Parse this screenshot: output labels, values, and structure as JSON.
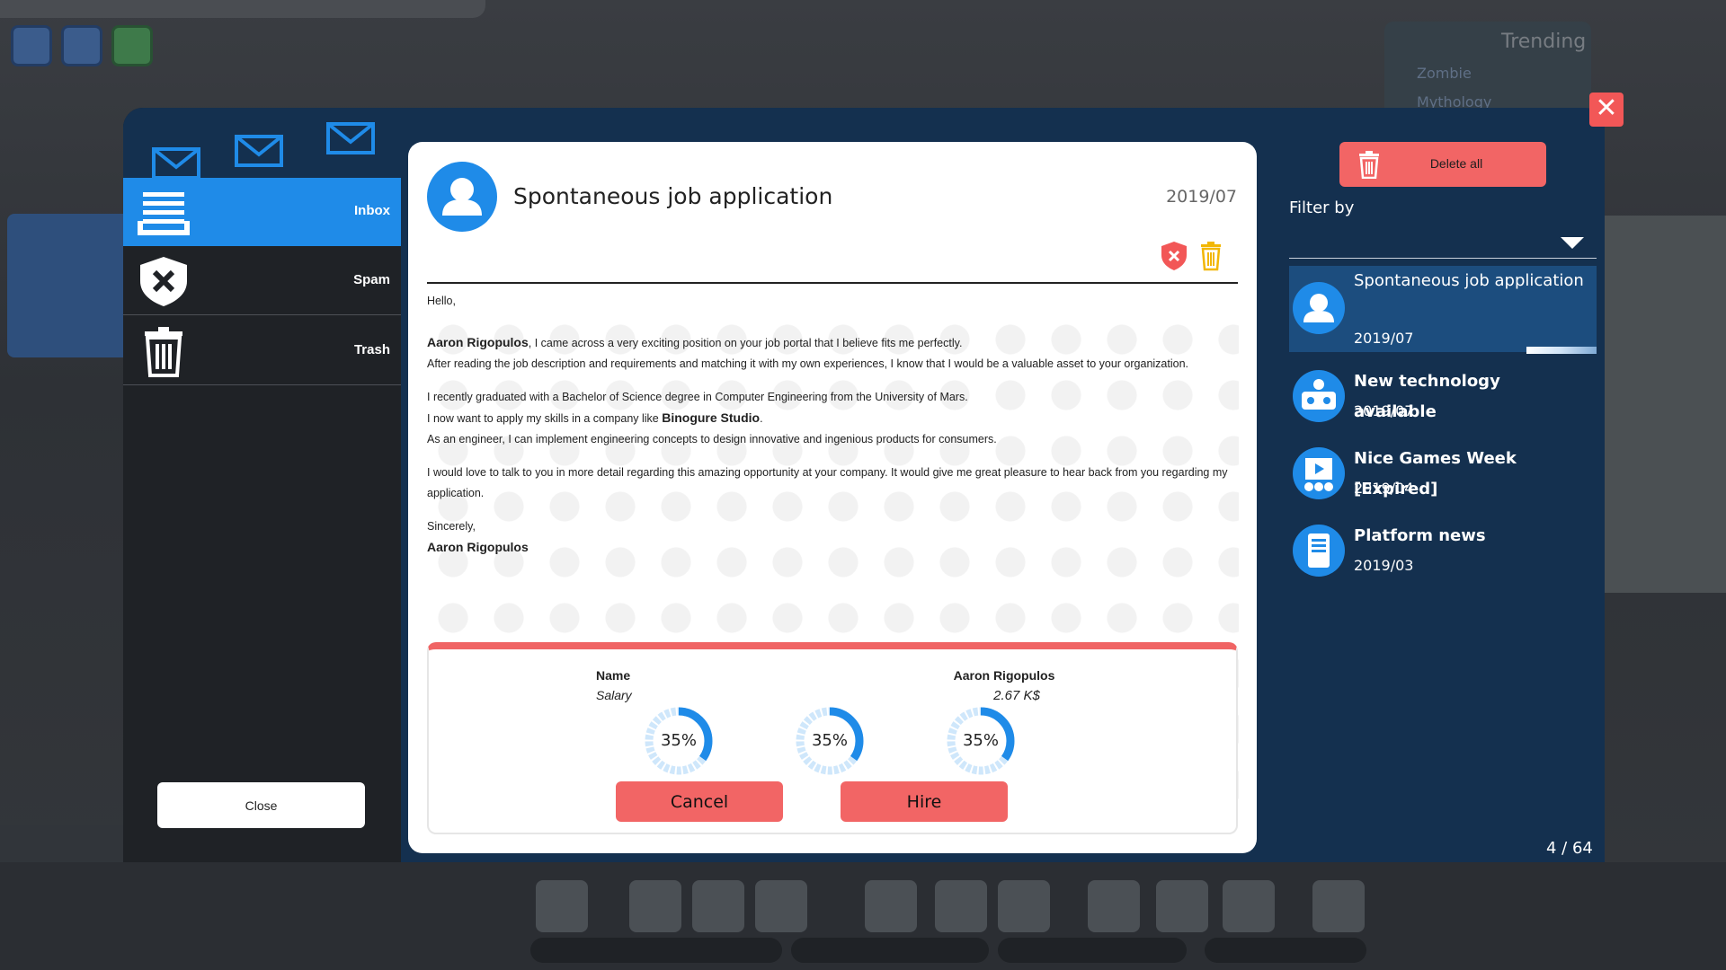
{
  "mail": {
    "folders": [
      {
        "label": "Inbox",
        "icon": "inbox-icon"
      },
      {
        "label": "Spam",
        "icon": "spam-shield-icon"
      },
      {
        "label": "Trash",
        "icon": "trash-icon"
      }
    ],
    "close_label": "Close",
    "message": {
      "title": "Spontaneous job application",
      "date": "2019/07",
      "greeting": "Hello,",
      "sender_name": "Aaron Rigopulos",
      "p1a": ", I came across a very exciting position on your job portal that I believe fits me perfectly.",
      "p1b": "After reading the job description and requirements and matching it with my own experiences, I know that I would be a valuable asset to your organization.",
      "p2a": "I recently graduated with a Bachelor of Science degree in Computer Engineering from the University of Mars.",
      "p2b_pre": "I now want to apply my skills in a company like ",
      "company": "Binogure Studio",
      "p2b_post": ".",
      "p2c": "As an engineer, I can implement engineering concepts to design innovative and ingenious products for consumers.",
      "p3": "I would love to talk to you in more detail regarding this amazing opportunity at your company. It would give me great pleasure to hear back from you regarding my application.",
      "signoff": "Sincerely,",
      "signature": "Aaron Rigopulos"
    },
    "application": {
      "name_label": "Name",
      "salary_label": "Salary",
      "name_value": "Aaron Rigopulos",
      "salary_value": "2.67 K$",
      "gauges": [
        {
          "label": "35%",
          "value": 0.35
        },
        {
          "label": "35%",
          "value": 0.35
        },
        {
          "label": "35%",
          "value": 0.35
        }
      ],
      "cancel_label": "Cancel",
      "hire_label": "Hire"
    },
    "sidebar": {
      "delete_all_label": "Delete all",
      "filter_label": "Filter by",
      "items": [
        {
          "title": "Spontaneous job application",
          "date": "2019/07",
          "icon": "person-avatar-icon"
        },
        {
          "title": "New technology available",
          "date": "2019/07",
          "icon": "technology-icon"
        },
        {
          "title": "Nice Games Week [Expired]",
          "date": "2019/04",
          "icon": "event-icon"
        },
        {
          "title": "Platform news",
          "date": "2019/03",
          "icon": "platform-icon"
        }
      ],
      "pager": "4 / 64"
    }
  },
  "background": {
    "trending_title": "Trending",
    "trending_items": [
      "Zombie",
      "Mythology"
    ]
  },
  "colors": {
    "accent_blue": "#1f8be8",
    "danger_red": "#f26565",
    "panel_navy": "#14304f"
  }
}
